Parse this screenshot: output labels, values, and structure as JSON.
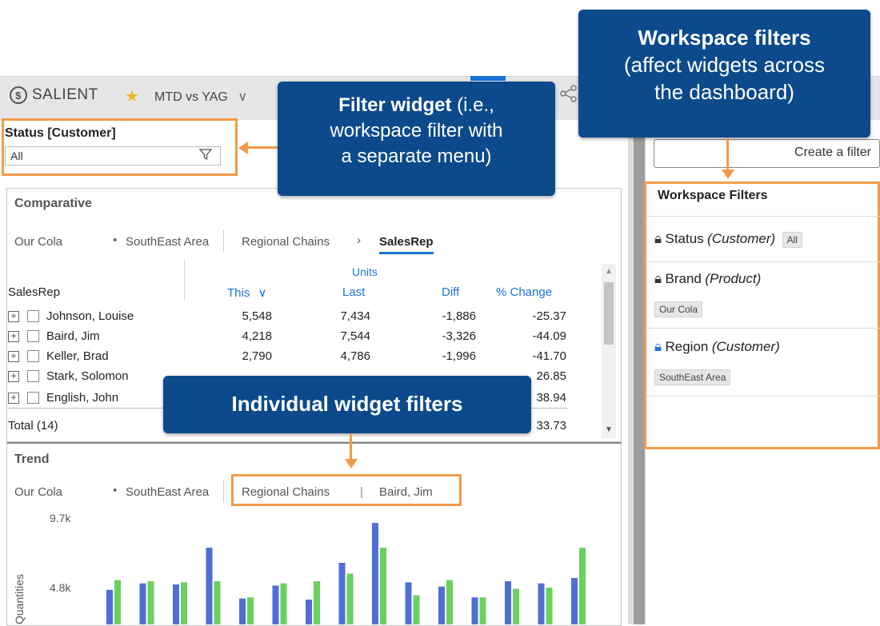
{
  "topbar": {
    "brand": "SALIENT",
    "brand_mark": "$",
    "favorite_icon": "star-icon",
    "period_label": "MTD vs YAG",
    "period_chevron": "∨",
    "share_icon": "share-icon"
  },
  "status_filter": {
    "title": "Status [Customer]",
    "value": "All",
    "icon": "funnel-icon"
  },
  "comparative": {
    "title": "Comparative",
    "filters": [
      "Our Cola",
      "SouthEast Area"
    ],
    "breadcrumb": [
      "Regional Chains",
      "SalesRep"
    ],
    "breadcrumb_separator": "›",
    "group_header": "Units",
    "row_header": "SalesRep",
    "columns": [
      "This",
      "Last",
      "Diff",
      "% Change"
    ],
    "sort_icon": "∨",
    "rows": [
      {
        "name": "Johnson, Louise",
        "this": "5,548",
        "last": "7,434",
        "diff": "-1,886",
        "pct": "-25.37"
      },
      {
        "name": "Baird, Jim",
        "this": "4,218",
        "last": "7,544",
        "diff": "-3,326",
        "pct": "-44.09"
      },
      {
        "name": "Keller, Brad",
        "this": "2,790",
        "last": "4,786",
        "diff": "-1,996",
        "pct": "-41.70"
      },
      {
        "name": "Stark, Solomon",
        "this": "",
        "last": "",
        "diff": "",
        "pct": "26.85"
      },
      {
        "name": "English, John",
        "this": "",
        "last": "",
        "diff": "",
        "pct": "38.94"
      }
    ],
    "total_label": "Total (14)",
    "total_pct": "33.73"
  },
  "trend": {
    "title": "Trend",
    "filters": [
      "Our Cola",
      "SouthEast Area"
    ],
    "widget_filters": [
      "Regional Chains",
      "Baird, Jim"
    ],
    "filter_divider": "|",
    "ylabel": "Quantities",
    "yticks": [
      "9.7k",
      "4.8k"
    ]
  },
  "chart_data": {
    "type": "bar",
    "title": "Trend",
    "ylabel": "Quantities",
    "ylim": [
      0,
      9700
    ],
    "yticks": [
      "9.7k",
      "4.8k"
    ],
    "series": [
      {
        "name": "This",
        "color": "#4f6fd6",
        "values": [
          3200,
          3800,
          3700,
          7100,
          2400,
          3600,
          2300,
          5700,
          9400,
          3900,
          3500,
          2500,
          4000,
          3800,
          4300
        ]
      },
      {
        "name": "Last",
        "color": "#6ad05e",
        "values": [
          4100,
          4000,
          3900,
          4000,
          2500,
          3800,
          4000,
          4700,
          7100,
          2700,
          4100,
          2500,
          3300,
          3400,
          7100
        ]
      }
    ]
  },
  "right_panel": {
    "create_filter": "Create a filter",
    "title": "Workspace Filters",
    "filters": [
      {
        "name": "Status",
        "dim": "(Customer)",
        "value": "All",
        "icon": "lock-icon",
        "icon_color": "#333333"
      },
      {
        "name": "Brand",
        "dim": "(Product)",
        "value": "Our Cola",
        "icon": "lock-icon",
        "icon_color": "#333333"
      },
      {
        "name": "Region",
        "dim": "(Customer)",
        "value": "SouthEast Area",
        "icon": "lock-icon",
        "icon_color": "#1a73d6"
      }
    ]
  },
  "callouts": {
    "filter_widget_bold": "Filter widget",
    "filter_widget_rest1": " (i.e.,",
    "filter_widget_line2": "workspace filter with",
    "filter_widget_line3": "a separate menu)",
    "workspace_bold": "Workspace filters",
    "workspace_line2": "(affect widgets across",
    "workspace_line3": "the dashboard)",
    "individual": "Individual widget filters"
  },
  "colors": {
    "accent": "#1a73d6",
    "callout_bg": "#0d4a8c",
    "highlight_orange": "#f39a4a"
  }
}
